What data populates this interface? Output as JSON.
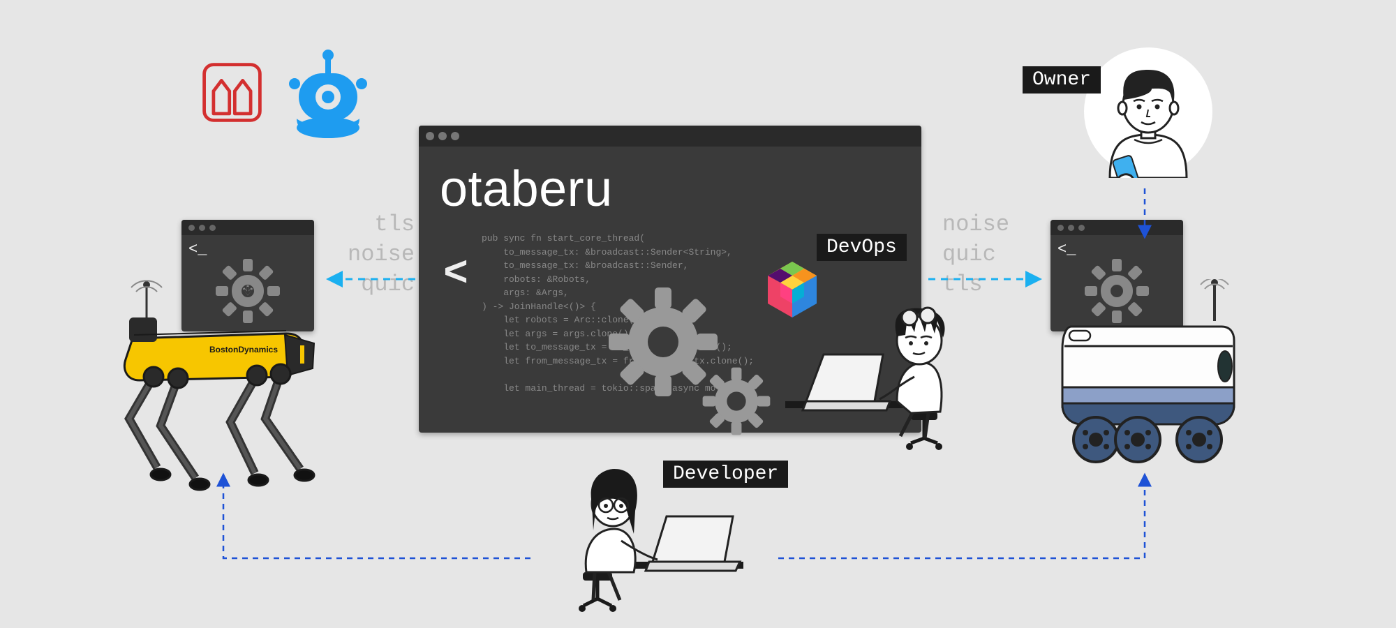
{
  "roles": {
    "owner": "Owner",
    "devops": "DevOps",
    "developer": "Developer"
  },
  "main_window": {
    "title": "otaberu",
    "code": "pub sync fn start_core_thread(\n    to_message_tx: &broadcast::Sender<String>,\n    to_message_tx: &broadcast::Sender,\n    robots: &Robots,\n    args: &Args,\n) -> JoinHandle<()> {\n    let robots = Arc::clone(&robots);\n    let args = args.clone();\n    let to_message_tx = to_message_tx.clone();\n    let from_message_tx = from_message_tx.clone();\n\n    let main_thread = tokio::spawn(async move {"
  },
  "protocols_left": [
    "tls",
    "noise",
    "quic"
  ],
  "protocols_right": [
    "noise",
    "quic",
    "tls"
  ],
  "robot_dog_brand": "BostonDynamics"
}
